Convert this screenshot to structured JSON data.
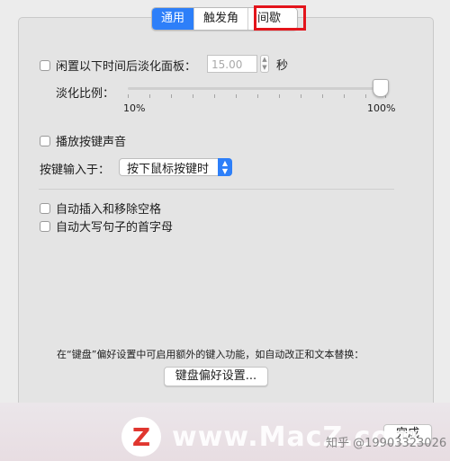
{
  "tabs": [
    {
      "label": "通用",
      "active": true
    },
    {
      "label": "触发角",
      "active": false
    },
    {
      "label": "间歇",
      "active": false
    }
  ],
  "fade": {
    "checkbox_label": "闲置以下时间后淡化面板：",
    "checked": false,
    "value": "15.00",
    "unit": "秒"
  },
  "fade_ratio": {
    "label": "淡化比例：",
    "min_label": "10%",
    "max_label": "100%",
    "value_percent": 100
  },
  "key_sound": {
    "label": "播放按键声音",
    "checked": false
  },
  "key_input": {
    "label": "按键输入于：",
    "selected": "按下鼠标按键时"
  },
  "spacing": {
    "label": "自动插入和移除空格",
    "checked": false
  },
  "capitalize": {
    "label": "自动大写句子的首字母",
    "checked": false
  },
  "keyboard_hint": "在“键盘”偏好设置中可启用额外的键入功能，如自动改正和文本替换：",
  "keyboard_pref_button": "键盘偏好设置...",
  "done_button": "完成",
  "watermark": {
    "site": "www.MacZ.com",
    "logo": "Z",
    "zhihu": "知乎 @19903323026"
  },
  "colors": {
    "accent": "#2d7ff9",
    "highlight": "#e3141b"
  }
}
